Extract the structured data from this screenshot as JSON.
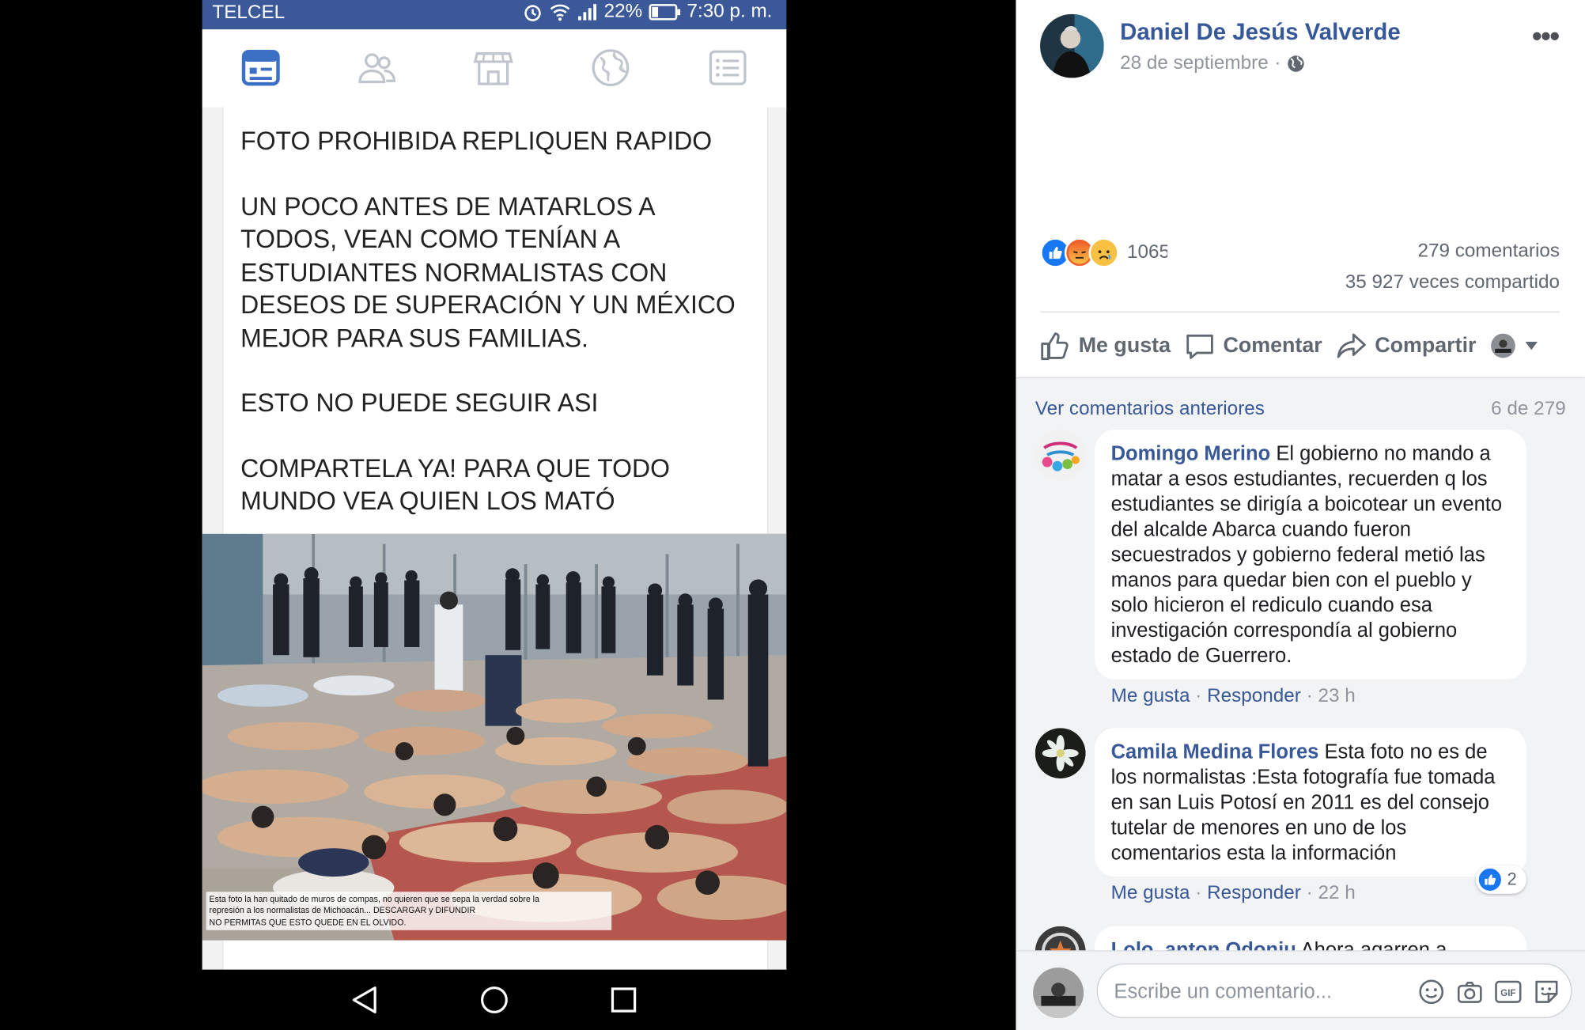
{
  "phone": {
    "status_bar": {
      "carrier": "TELCEL",
      "battery": "22%",
      "time": "7:30 p. m."
    },
    "nav_icons": [
      "news-feed-icon",
      "friends-icon",
      "marketplace-icon",
      "globe-icon",
      "menu-icon"
    ],
    "post": {
      "paragraphs": [
        "FOTO PROHIBIDA REPLIQUEN RAPIDO",
        "UN POCO ANTES DE MATARLOS A TODOS, VEAN COMO TENÍAN A ESTUDIANTES NORMALISTAS CON DESEOS DE SUPERACIÓN Y UN MÉXICO MEJOR PARA SUS FAMILIAS.",
        "ESTO NO PUEDE SEGUIR ASI",
        "COMPARTELA YA! PARA QUE TODO MUNDO VEA QUIEN LOS MATÓ"
      ],
      "photo_caption": [
        "Esta foto la han quitado de muros de compas, no quieren que se sepa la verdad sobre la",
        "represión a los normalistas de Michoacán... DESCARGAR y DIFUNDIR",
        "NO PERMITAS QUE ESTO QUEDE EN EL OLVIDO."
      ]
    },
    "android_nav": [
      "back-icon",
      "home-icon",
      "recents-icon"
    ]
  },
  "post_panel": {
    "author": "Daniel De Jesús Valverde",
    "date": "28 de septiembre",
    "privacy_icon": "globe-icon",
    "reaction_count": "1065",
    "comments_count": "279 comentarios",
    "shares_count": "35 927 veces compartido",
    "actions": {
      "like": "Me gusta",
      "comment": "Comentar",
      "share": "Compartir"
    },
    "previous_comments_link": "Ver comentarios anteriores",
    "comment_counter": "6 de 279",
    "comments": [
      {
        "name": "Domingo Merino",
        "text": "El gobierno no mando a matar a esos estudiantes, recuerden q los estudiantes se dirigía a boicotear un evento del alcalde Abarca cuando fueron secuestrados y gobierno federal metió las manos para quedar bien con el pueblo y solo hicieron el rediculo cuando esa investigación correspondía al gobierno estado de Guerrero.",
        "like": "Me gusta",
        "reply": "Responder",
        "time": "23 h"
      },
      {
        "name": "Camila Medina Flores",
        "text": "Esta foto no es de los normalistas :Esta fotografía fue tomada en san Luis Potosí en 2011 es del consejo tutelar de menores en uno de los comentarios esta la información",
        "like": "Me gusta",
        "reply": "Responder",
        "time": "22 h",
        "likes": "2"
      },
      {
        "name": "Lolo_anton Odoniu",
        "text": "Ahora agarren a"
      }
    ],
    "composer_placeholder": "Escribe un comentario..."
  }
}
